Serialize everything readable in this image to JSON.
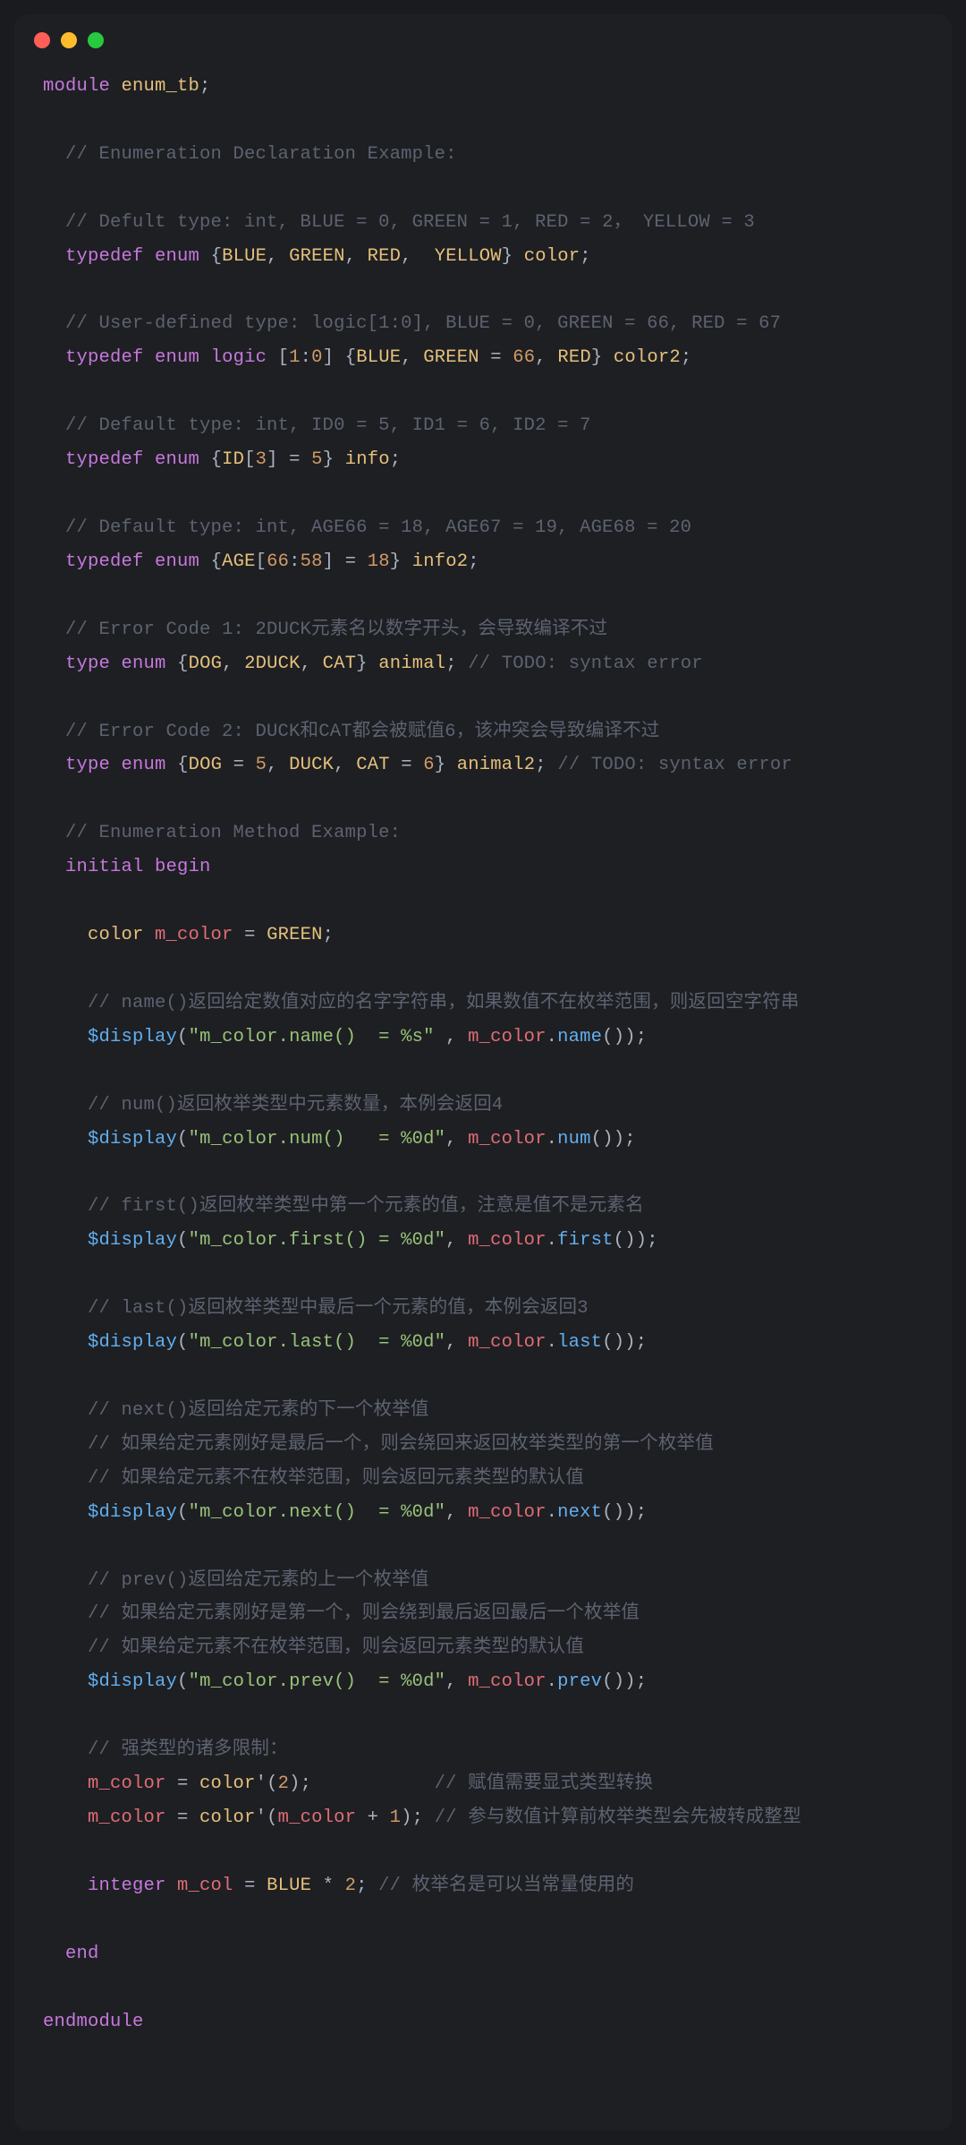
{
  "window": {
    "dots": [
      "red",
      "yellow",
      "green"
    ]
  },
  "code": {
    "l1_kw_module": "module",
    "l1_name": "enum_tb",
    "l1_semi": ";",
    "c_decl": "// Enumeration Declaration Example:",
    "c_def": "// Defult type: int, BLUE = 0, GREEN = 1, RED = 2， YELLOW = 3",
    "td_kw_typedef": "typedef",
    "td_kw_enum": "enum",
    "td_open": "{",
    "td_close": "}",
    "td_blue": "BLUE",
    "td_green": "GREEN",
    "td_red": "RED",
    "td_yellow": "YELLOW",
    "td_color": "color",
    "td_color2": "color2",
    "td_comma": ", ",
    "td_commaw": ",  ",
    "c_user": "// User-defined type: logic[1:0], BLUE = 0, GREEN = 66, RED = 67",
    "td_logic": "logic",
    "td_range_open": "[",
    "td_range_close": "]",
    "td_range_1": "1",
    "td_range_0": "0",
    "td_colon": ":",
    "td_eq": " = ",
    "td_66": "66",
    "c_id": "// Default type: int, ID0 = 5, ID1 = 6, ID2 = 7",
    "td_ID": "ID",
    "td_3": "3",
    "td_5": "5",
    "td_info": "info",
    "c_age": "// Default type: int, AGE66 = 18, AGE67 = 19, AGE68 = 20",
    "td_AGE": "AGE",
    "td_66b": "66",
    "td_58": "58",
    "td_18": "18",
    "td_info2": "info2",
    "c_err1": "// Error Code 1: 2DUCK元素名以数字开头，会导致编译不过",
    "td_type": "type",
    "td_DOG": "DOG",
    "td_2DUCK": "2DUCK",
    "td_CAT": "CAT",
    "td_animal": "animal",
    "c_todo_err": "// TODO: syntax error",
    "c_err2": "// Error Code 2: DUCK和CAT都会被赋值6，该冲突会导致编译不过",
    "td_DUCK": "DUCK",
    "td_6": "6",
    "td_animal2": "animal2",
    "c_method": "// Enumeration Method Example:",
    "kw_initial": "initial",
    "kw_begin": "begin",
    "kw_end": "end",
    "mc_decl_type": "color",
    "mc_var": "m_color",
    "mc_green": "GREEN",
    "c_name": "// name()返回给定数值对应的名字字符串，如果数值不在枚举范围，则返回空字符串",
    "disp": "$display",
    "str_name": "\"m_color.name()  = %s\"",
    "call_name": "name",
    "c_num": "// num()返回枚举类型中元素数量，本例会返回4",
    "str_num": "\"m_color.num()   = %0d\"",
    "call_num": "num",
    "c_first": "// first()返回枚举类型中第一个元素的值，注意是值不是元素名",
    "str_first": "\"m_color.first() = %0d\"",
    "call_first": "first",
    "c_last": "// last()返回枚举类型中最后一个元素的值，本例会返回3",
    "str_last": "\"m_color.last()  = %0d\"",
    "call_last": "last",
    "c_next1": "// next()返回给定元素的下一个枚举值",
    "c_next2": "// 如果给定元素刚好是最后一个，则会绕回来返回枚举类型的第一个枚举值",
    "c_next3": "// 如果给定元素不在枚举范围，则会返回元素类型的默认值",
    "str_next": "\"m_color.next()  = %0d\"",
    "call_next": "next",
    "c_prev1": "// prev()返回给定元素的上一个枚举值",
    "c_prev2": "// 如果给定元素刚好是第一个，则会绕到最后返回最后一个枚举值",
    "c_prev3": "// 如果给定元素不在枚举范围，则会返回元素类型的默认值",
    "str_prev": "\"m_color.prev()  = %0d\"",
    "call_prev": "prev",
    "c_strong": "// 强类型的诸多限制：",
    "cast_2": "2",
    "cast_1": "1",
    "c_cast1": "// 赋值需要显式类型转换",
    "c_cast2": "// 参与数值计算前枚举类型会先被转成整型",
    "kw_integer": "integer",
    "mcol_var": "m_col",
    "mcol_blue": "BLUE",
    "mcol_2": "2",
    "c_mcol": "// 枚举名是可以当常量使用的",
    "kw_endmodule": "endmodule",
    "sp2": "  ",
    "sp4": "    ",
    "semi": ";",
    "lp": "(",
    "rp": ")",
    "dot": ".",
    "comma_sp": ", ",
    "comma_sp2": " , ",
    "star": " * ",
    "plus": " + ",
    "tick": "'"
  }
}
